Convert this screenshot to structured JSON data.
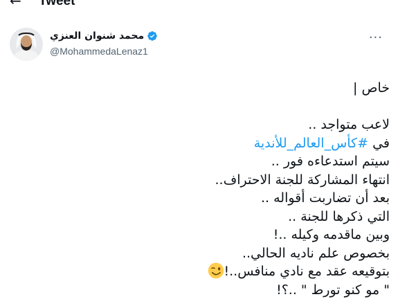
{
  "header": {
    "back_icon": "back-arrow-icon",
    "title": "Tweet"
  },
  "author": {
    "display_name": "محمد شنوان العنزي",
    "handle": "@MohammedaLenaz1",
    "verified_icon": "verified-badge-icon",
    "more_icon": "more-options-icon"
  },
  "tweet": {
    "lines": [
      "خاص |",
      "",
      "لاعب متواجد ..",
      "في #كأس_العالم_للأندية",
      "سيتم استدعاءه فور ..",
      "انتهاء المشاركة للجنة الاحتراف..",
      "بعد أن تضاربت أقواله ..",
      "التي ذكرها للجنة ..",
      "وبين ماقدمه وكيله ..!",
      "بخصوص علم ناديه الحالي..",
      "بتوقيعه عقد مع نادي منافس..!",
      "\" مو كنو تورط \" ..؟!"
    ],
    "hashtag_prefix": "في ",
    "hashtag": "#كأس_العالم_للأندية",
    "emoji_icon": "winking-face-emoji"
  },
  "colors": {
    "accent": "#1d9bf0",
    "text": "#0f1419",
    "secondary": "#536471"
  }
}
